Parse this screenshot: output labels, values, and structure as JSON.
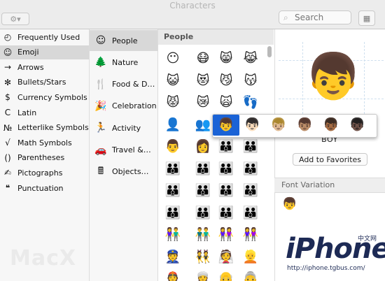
{
  "window": {
    "title": "Characters"
  },
  "toolbar": {
    "gear_glyph": "⚙▾",
    "search_placeholder": "Search",
    "grid_icon": "▦"
  },
  "categories": [
    {
      "label": "Frequently Used",
      "icon": "◴",
      "selected": false
    },
    {
      "label": "Emoji",
      "icon": "☺",
      "selected": true
    },
    {
      "label": "Arrows",
      "icon": "→",
      "selected": false
    },
    {
      "label": "Bullets/Stars",
      "icon": "✻",
      "selected": false
    },
    {
      "label": "Currency Symbols",
      "icon": "$",
      "selected": false
    },
    {
      "label": "Latin",
      "icon": "C",
      "selected": false
    },
    {
      "label": "Letterlike Symbols",
      "icon": "№",
      "selected": false
    },
    {
      "label": "Math Symbols",
      "icon": "√",
      "selected": false
    },
    {
      "label": "Parentheses",
      "icon": "()",
      "selected": false
    },
    {
      "label": "Pictographs",
      "icon": "✍",
      "selected": false
    },
    {
      "label": "Punctuation",
      "icon": "❝",
      "selected": false
    }
  ],
  "emoji_groups": [
    {
      "label": "People",
      "icon": "☺",
      "selected": true
    },
    {
      "label": "Nature",
      "icon": "🌲",
      "selected": false
    },
    {
      "label": "Food & D…",
      "icon": "🍴",
      "selected": false
    },
    {
      "label": "Celebration",
      "icon": "🎉",
      "selected": false
    },
    {
      "label": "Activity",
      "icon": "🏃",
      "selected": false
    },
    {
      "label": "Travel &…",
      "icon": "🚗",
      "selected": false
    },
    {
      "label": "Objects…",
      "icon": "🖩",
      "selected": false
    }
  ],
  "section_label": "People",
  "emoji_rows": [
    [
      "😶",
      "😷",
      "😸",
      "😹"
    ],
    [
      "😺",
      "😻",
      "😼",
      "😽"
    ],
    [
      "😾",
      "😿",
      "🙀",
      "👣"
    ],
    [
      "👤",
      "👥",
      "👦",
      "👧"
    ],
    [
      "👨",
      "👩",
      "👪",
      "👪"
    ],
    [
      "👪",
      "👪",
      "👪",
      "👪"
    ],
    [
      "👪",
      "👪",
      "👪",
      "👪"
    ],
    [
      "👪",
      "👪",
      "👪",
      "👪"
    ],
    [
      "👫",
      "👬",
      "👭",
      "👭"
    ],
    [
      "👮",
      "👯",
      "👰",
      "👱"
    ],
    [
      "👲",
      "👳",
      "👴",
      "👵"
    ]
  ],
  "detail": {
    "glyph": "👦",
    "name": "BOY",
    "favorites_button": "Add to Favorites",
    "font_variation_label": "Font Variation",
    "variation_glyph": "👦"
  },
  "skin_tone_popup": [
    "👦",
    "👦🏻",
    "👦🏼",
    "👦🏽",
    "👦🏾",
    "👦🏿"
  ],
  "watermarks": {
    "macx": "MacX",
    "iphone": "iPhone",
    "zhongwen": "中文网",
    "url": "http://iphone.tgbus.com/"
  },
  "colors": {
    "selection": "#1b63d6",
    "sidebar_bg": "#f7f7f7",
    "selected_row": "#d8d8d8"
  }
}
